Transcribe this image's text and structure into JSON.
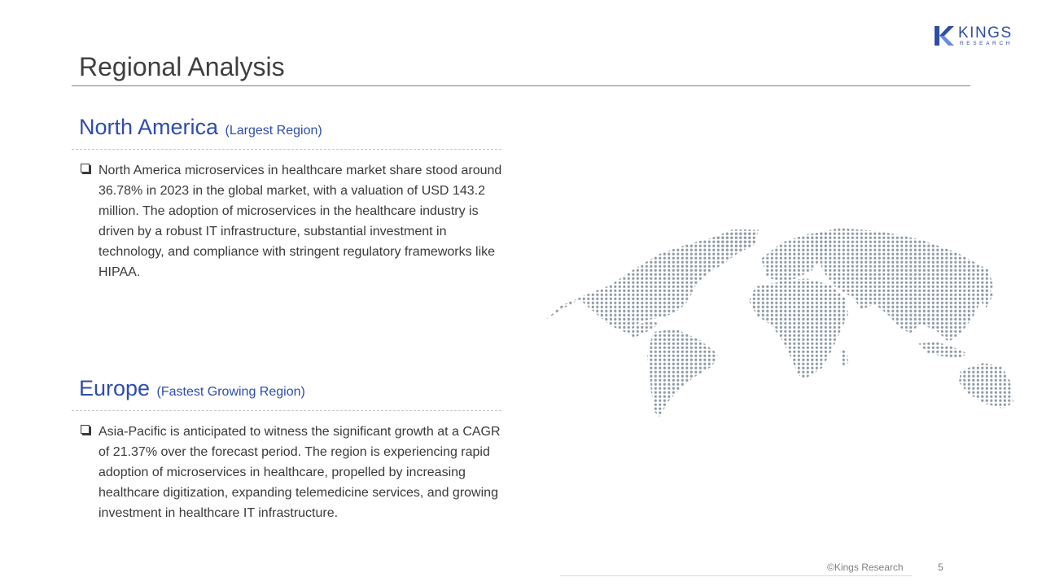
{
  "brand": {
    "name": "KINGS",
    "tagline": "RESEARCH",
    "color": "#2f4ea5"
  },
  "page": {
    "title": "Regional Analysis"
  },
  "sections": [
    {
      "region": "North America",
      "note": "(Largest Region)",
      "text": "North America microservices in healthcare market share stood around 36.78% in 2023 in the global market, with a valuation of USD 143.2 million. The adoption of microservices in the healthcare industry is driven by a robust IT infrastructure, substantial investment in technology, and compliance with stringent regulatory frameworks like HIPAA."
    },
    {
      "region": "Europe",
      "note": "(Fastest Growing Region)",
      "text": "Asia-Pacific is anticipated to witness the significant growth at a CAGR of 21.37% over the forecast period. The region is experiencing rapid adoption of microservices in healthcare, propelled by increasing healthcare digitization, expanding telemedicine services, and growing investment in healthcare IT infrastructure."
    }
  ],
  "footer": {
    "copyright": "©Kings Research",
    "page_number": "5"
  },
  "colors": {
    "heading": "#2e4dae",
    "body_text": "#3a3a3a",
    "map_dots": "#8f9aa3"
  },
  "icons": {
    "bullet": "checkbox-bullet-icon",
    "map": "world-map-dots"
  }
}
